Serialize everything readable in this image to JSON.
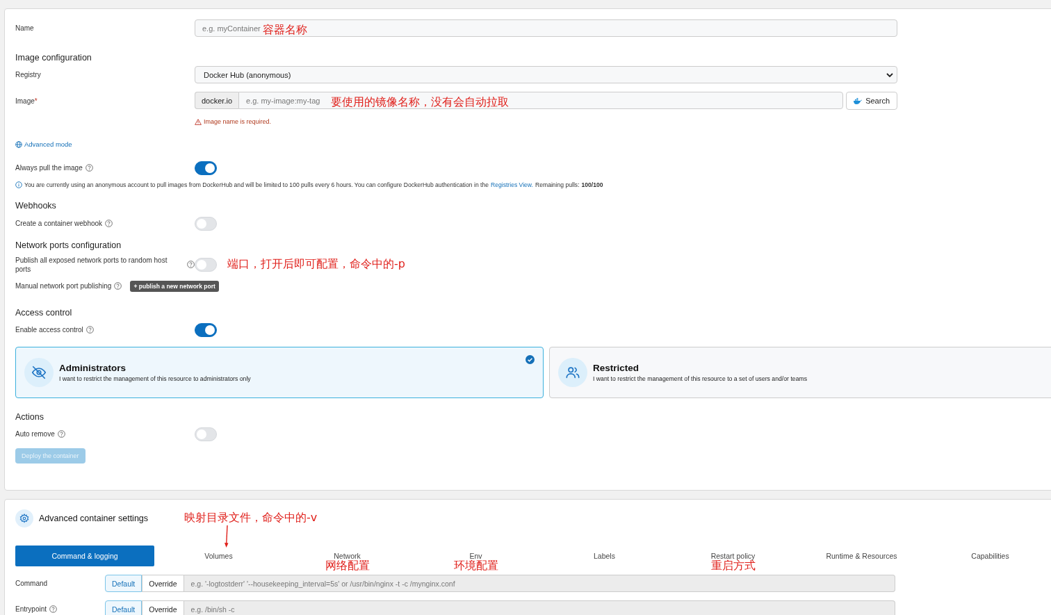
{
  "name_field": {
    "label": "Name",
    "placeholder": "e.g. myContainer",
    "note": "容器名称"
  },
  "image_configuration": {
    "title": "Image configuration",
    "registry": {
      "label": "Registry",
      "value": "Docker Hub (anonymous)"
    },
    "image": {
      "label": "Image",
      "required_mark": "*",
      "prefix": "docker.io",
      "placeholder": "e.g. my-image:my-tag",
      "note": "要使用的镜像名称，没有会自动拉取",
      "search_button": "Search",
      "error": "Image name is required."
    },
    "advanced_mode_link": "Advanced mode",
    "always_pull": {
      "label": "Always pull the image",
      "on": true
    },
    "info": {
      "text": "You are currently using an anonymous account to pull images from DockerHub and will be limited to 100 pulls every 6 hours. You can configure DockerHub authentication in the",
      "link": "Registries View.",
      "after": "Remaining pulls: **100/100**"
    }
  },
  "webhooks": {
    "title": "Webhooks",
    "toggle": {
      "label": "Create a container webhook",
      "on": false
    }
  },
  "network_ports": {
    "title": "Network ports configuration",
    "publish_all": {
      "label": "Publish all exposed network ports to random host ports",
      "on": false,
      "note": "端口，打开后即可配置，命令中的-p"
    },
    "manual": {
      "label": "Manual network port publishing",
      "button": "+ publish a new network port"
    }
  },
  "access_control": {
    "title": "Access control",
    "toggle": {
      "label": "Enable access control",
      "on": true
    },
    "options": [
      {
        "kind": "admins",
        "title": "Administrators",
        "description": "I want to restrict the management of this resource to administrators only",
        "selected": true
      },
      {
        "kind": "restricted",
        "title": "Restricted",
        "description": "I want to restrict the management of this resource to a set of users and/or teams",
        "selected": false
      }
    ]
  },
  "actions": {
    "title": "Actions",
    "auto_remove": {
      "label": "Auto remove",
      "on": false
    },
    "deploy_button": {
      "label": "Deploy the container",
      "disabled": true
    }
  },
  "advanced_settings": {
    "title": "Advanced container settings",
    "tabs": [
      {
        "label": "Command & logging",
        "selected": true
      },
      {
        "label": "Volumes",
        "selected": false,
        "note": {
          "text": "映射目录文件，命令中的-v",
          "arrow": true
        }
      },
      {
        "label": "Network",
        "selected": false,
        "note": {
          "text": "网络配置",
          "arrow": false
        }
      },
      {
        "label": "Env",
        "selected": false,
        "note": {
          "text": "环境配置",
          "arrow": false
        }
      },
      {
        "label": "Labels",
        "selected": false
      },
      {
        "label": "Restart policy",
        "selected": false,
        "note": {
          "text": "重启方式",
          "arrow": false
        }
      },
      {
        "label": "Runtime & Resources",
        "selected": false
      },
      {
        "label": "Capabilities",
        "selected": false
      }
    ],
    "fields": [
      {
        "label": "Command",
        "help": false,
        "modes": [
          {
            "label": "Default",
            "selected": true
          },
          {
            "label": "Override",
            "selected": false
          }
        ],
        "placeholder": "e.g. '-logtostderr' '--housekeeping_interval=5s' or /usr/bin/nginx -t -c /mynginx.conf"
      },
      {
        "label": "Entrypoint",
        "help": true,
        "modes": [
          {
            "label": "Default",
            "selected": true
          },
          {
            "label": "Override",
            "selected": false
          }
        ],
        "placeholder": "e.g. /bin/sh -c"
      }
    ]
  }
}
